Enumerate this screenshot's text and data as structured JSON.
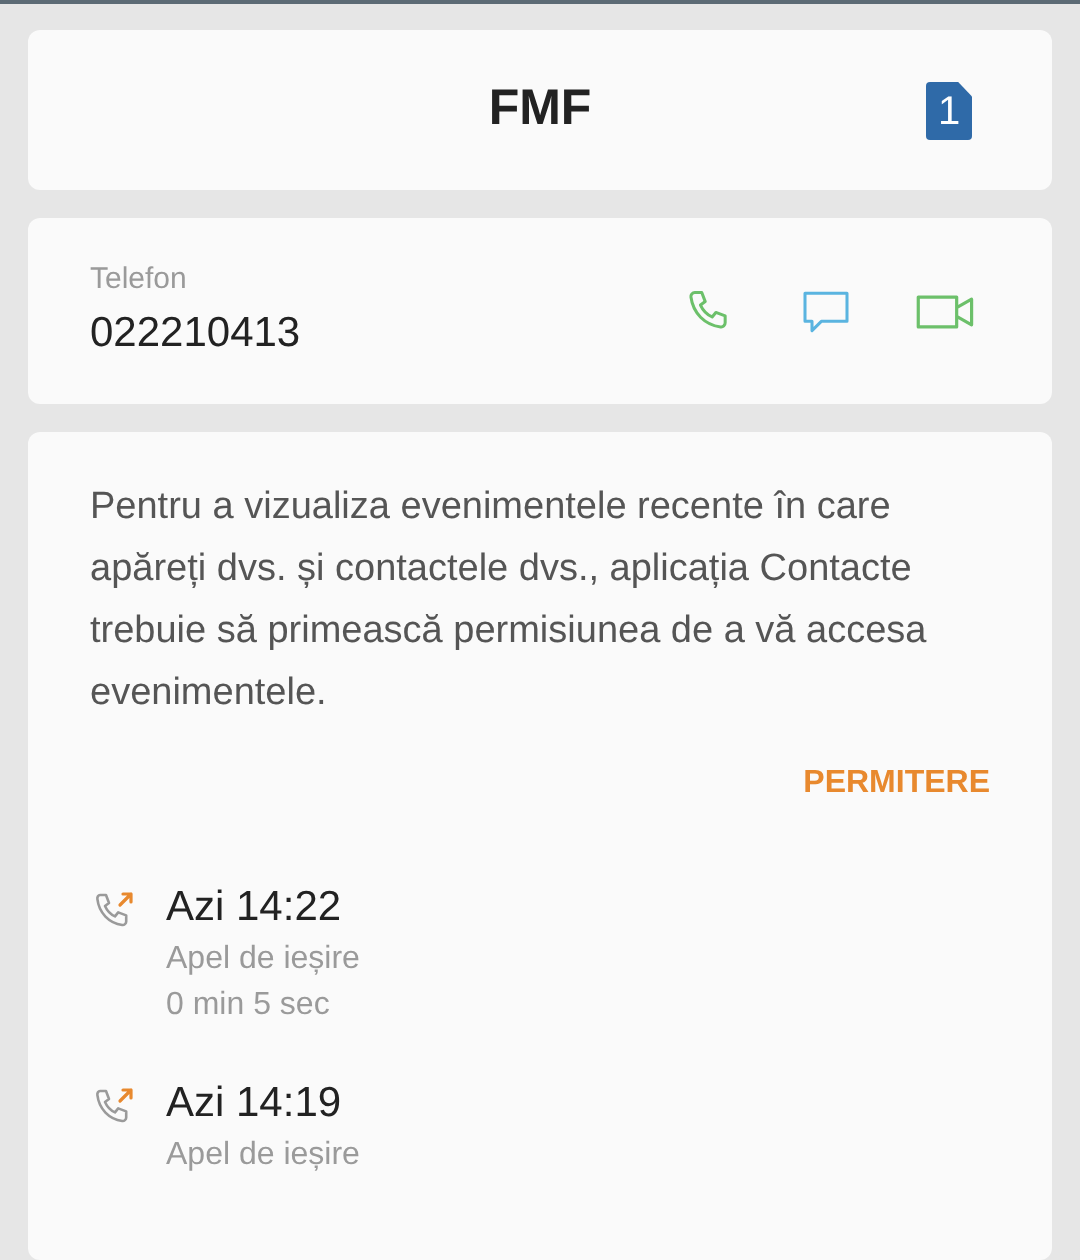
{
  "header": {
    "title": "FMF",
    "sim": "1"
  },
  "contact": {
    "label": "Telefon",
    "number": "022210413"
  },
  "permission": {
    "message": "Pentru a vizualiza evenimentele recente în care apăreți dvs. și contactele dvs., aplicația Contacte trebuie să primească permisiunea de a vă accesa evenimentele.",
    "action": "PERMITERE"
  },
  "calls": [
    {
      "kind": "outgoing",
      "time": "Azi 14:22",
      "details": [
        "Apel de ieșire",
        "0 min 5 sec"
      ]
    },
    {
      "kind": "outgoing",
      "time": "Azi 14:19",
      "details": [
        "Apel de ieșire"
      ]
    }
  ]
}
